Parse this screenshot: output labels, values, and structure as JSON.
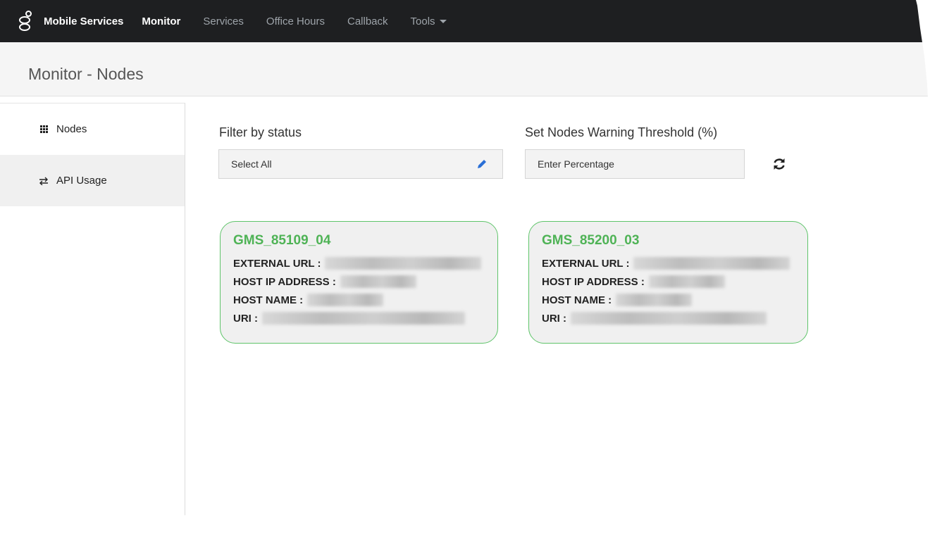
{
  "app": {
    "brand": "Mobile Services"
  },
  "nav": {
    "items": [
      {
        "label": "Monitor",
        "active": true
      },
      {
        "label": "Services",
        "active": false
      },
      {
        "label": "Office Hours",
        "active": false
      },
      {
        "label": "Callback",
        "active": false
      },
      {
        "label": "Tools",
        "active": false,
        "dropdown": true
      }
    ]
  },
  "page": {
    "title": "Monitor - Nodes"
  },
  "sidebar": {
    "items": [
      {
        "label": "Nodes",
        "icon": "grid-icon",
        "active": true
      },
      {
        "label": "API Usage",
        "icon": "exchange-arrows-icon",
        "active": false
      }
    ]
  },
  "filter": {
    "label": "Filter by status",
    "value": "Select All"
  },
  "threshold": {
    "label": "Set Nodes Warning Threshold (%)",
    "placeholder": "Enter Percentage"
  },
  "nodes": [
    {
      "name": "GMS_85109_04",
      "external_url_label": "EXTERNAL URL :",
      "host_ip_label": "HOST IP ADDRESS :",
      "host_name_label": "HOST NAME :",
      "uri_label": "URI :"
    },
    {
      "name": "GMS_85200_03",
      "external_url_label": "EXTERNAL URL :",
      "host_ip_label": "HOST IP ADDRESS :",
      "host_name_label": "HOST NAME :",
      "uri_label": "URI :"
    }
  ],
  "colors": {
    "nav_bg": "#1e1f21",
    "node_ok": "#4fb356",
    "accent_blue": "#2a6fd6"
  }
}
